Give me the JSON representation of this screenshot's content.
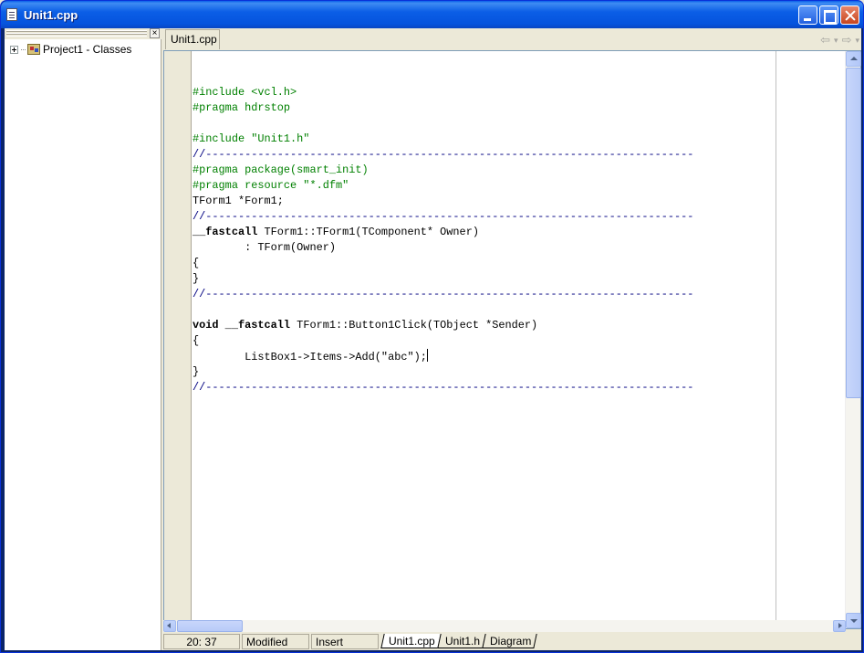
{
  "window": {
    "title": "Unit1.cpp"
  },
  "class_explorer": {
    "close_glyph": "×",
    "tree": [
      {
        "label": "Project1 - Classes",
        "expanded": false
      }
    ]
  },
  "editor": {
    "active_tab": "Unit1.cpp",
    "nav": {
      "back": "⇦",
      "back_drop": "▾",
      "forward": "⇨",
      "forward_drop": "▾"
    },
    "lines": [
      {
        "kind": "plain",
        "text": ""
      },
      {
        "kind": "pre",
        "text": "#include <vcl.h>"
      },
      {
        "kind": "pre",
        "text": "#pragma hdrstop"
      },
      {
        "kind": "plain",
        "text": ""
      },
      {
        "kind": "pre",
        "text": "#include \"Unit1.h\""
      },
      {
        "kind": "cmt",
        "text": "//---------------------------------------------------------------------------"
      },
      {
        "kind": "pre",
        "text": "#pragma package(smart_init)"
      },
      {
        "kind": "pre",
        "text": "#pragma resource \"*.dfm\""
      },
      {
        "kind": "plain",
        "text": "TForm1 *Form1;"
      },
      {
        "kind": "cmt",
        "text": "//---------------------------------------------------------------------------"
      },
      {
        "kind": "mixed",
        "kw": "__fastcall",
        "rest": " TForm1::TForm1(TComponent* Owner)"
      },
      {
        "kind": "plain",
        "text": "        : TForm(Owner)"
      },
      {
        "kind": "plain",
        "text": "{"
      },
      {
        "kind": "plain",
        "text": "}"
      },
      {
        "kind": "cmt",
        "text": "//---------------------------------------------------------------------------"
      },
      {
        "kind": "plain",
        "text": ""
      },
      {
        "kind": "mixed",
        "kw": "void __fastcall",
        "rest": " TForm1::Button1Click(TObject *Sender)"
      },
      {
        "kind": "plain",
        "text": "{"
      },
      {
        "kind": "caret",
        "text": "        ListBox1->Items->Add(\"abc\");"
      },
      {
        "kind": "plain",
        "text": "}"
      },
      {
        "kind": "cmt",
        "text": "//---------------------------------------------------------------------------"
      }
    ]
  },
  "status": {
    "position": "20:  37",
    "modified": "Modified",
    "mode": "Insert",
    "file_tabs": [
      "Unit1.cpp",
      "Unit1.h",
      "Diagram"
    ],
    "active_file_tab": "Unit1.cpp"
  },
  "colors": {
    "preprocessor": "#008000",
    "comment": "#000080",
    "title_bar": "#0553dd"
  }
}
